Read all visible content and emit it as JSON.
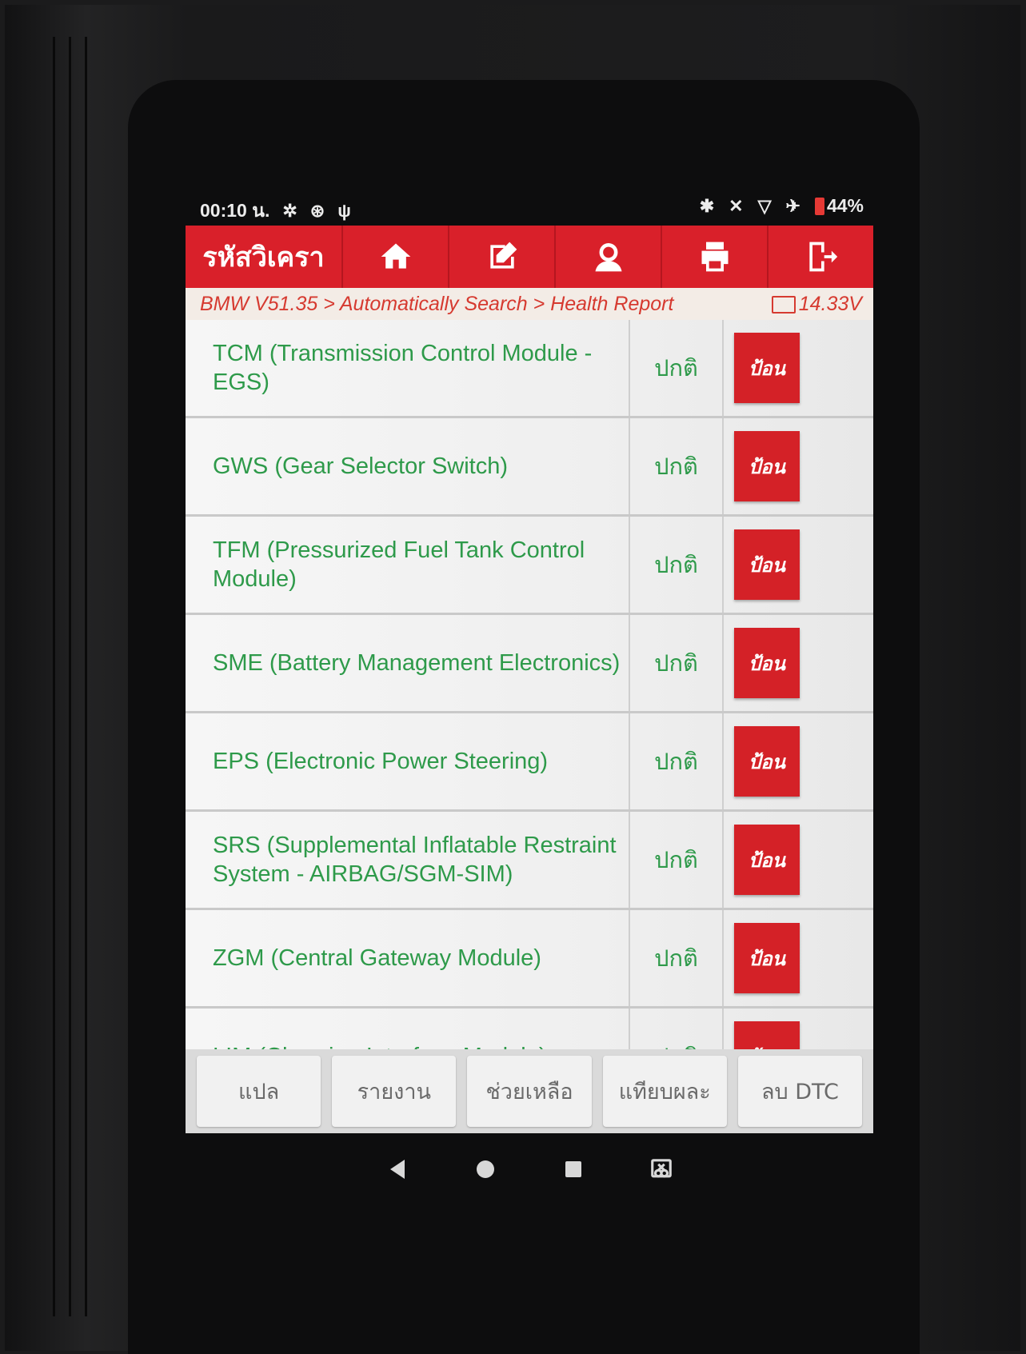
{
  "status_bar": {
    "time": "00:10 น.",
    "battery_percent": "44%",
    "left_icons": [
      "gear-icon",
      "accessibility-icon",
      "usb-icon"
    ],
    "right_icons": [
      "bluetooth-icon",
      "mute-icon",
      "wifi-icon",
      "airplane-icon",
      "battery-icon"
    ]
  },
  "header": {
    "title": "รหัสวิเครา",
    "buttons": [
      "home-icon",
      "edit-icon",
      "user-icon",
      "print-icon",
      "exit-icon"
    ],
    "accent_color": "#d9202a"
  },
  "breadcrumb": {
    "items": [
      "BMW V51.35",
      "Automatically Search",
      "Health Report"
    ],
    "separator": " > ",
    "voltage": "14.33V"
  },
  "modules": [
    {
      "name": "TCM (Transmission Control Module - EGS)",
      "status": "ปกติ",
      "action": "ป้อน"
    },
    {
      "name": "GWS (Gear Selector Switch)",
      "status": "ปกติ",
      "action": "ป้อน"
    },
    {
      "name": "TFM (Pressurized Fuel Tank Control Module)",
      "status": "ปกติ",
      "action": "ป้อน"
    },
    {
      "name": "SME (Battery Management Electronics)",
      "status": "ปกติ",
      "action": "ป้อน"
    },
    {
      "name": "EPS (Electronic Power Steering)",
      "status": "ปกติ",
      "action": "ป้อน"
    },
    {
      "name": "SRS (Supplemental Inflatable Restraint System - AIRBAG/SGM-SIM)",
      "status": "ปกติ",
      "action": "ป้อน"
    },
    {
      "name": "ZGM (Central Gateway Module)",
      "status": "ปกติ",
      "action": "ป้อน"
    },
    {
      "name": "LIM (Charging Interface Module)",
      "status": "ปกติ",
      "action": "ป้อน"
    }
  ],
  "bottom_buttons": {
    "translate": "แปล",
    "report": "รายงาน",
    "help": "ช่วยเหลือ",
    "compare": "แทียบผละ",
    "clear_dtc": "ลบ DTC"
  }
}
